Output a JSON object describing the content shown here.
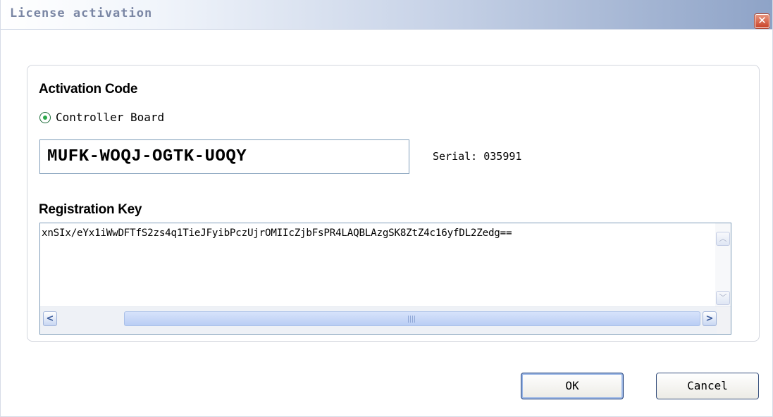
{
  "window": {
    "title": "License activation",
    "close_glyph": "✕"
  },
  "activation": {
    "heading": "Activation Code",
    "radio_label": "Controller Board",
    "radio_selected": true,
    "code_value": "MUFK-WOQJ-OGTK-UOQY",
    "serial_text": "Serial: 035991"
  },
  "registration": {
    "heading": "Registration Key",
    "key_value": "xnSIx/eYx1iWwDFTfS2zs4q1TieJFyibPczUjrOMIIcZjbFsPR4LAQBLAzgSK8ZtZ4c16yfDL2Zedg==",
    "scroll_up_glyph": "︿",
    "scroll_down_glyph": "﹀",
    "scroll_left_glyph": "<",
    "scroll_right_glyph": ">"
  },
  "buttons": {
    "ok_label": "OK",
    "cancel_label": "Cancel"
  },
  "colors": {
    "title_text": "#7a86a4",
    "close_button": "#c9442a",
    "radio_dot": "#2aa84a",
    "input_border": "#7f9db9",
    "default_button_border": "#1f3f7a"
  },
  "icons": {
    "close": "close-icon",
    "radio": "radio-selected-icon",
    "scroll_up": "chevron-up-icon",
    "scroll_down": "chevron-down-icon",
    "scroll_left": "chevron-left-icon",
    "scroll_right": "chevron-right-icon"
  }
}
